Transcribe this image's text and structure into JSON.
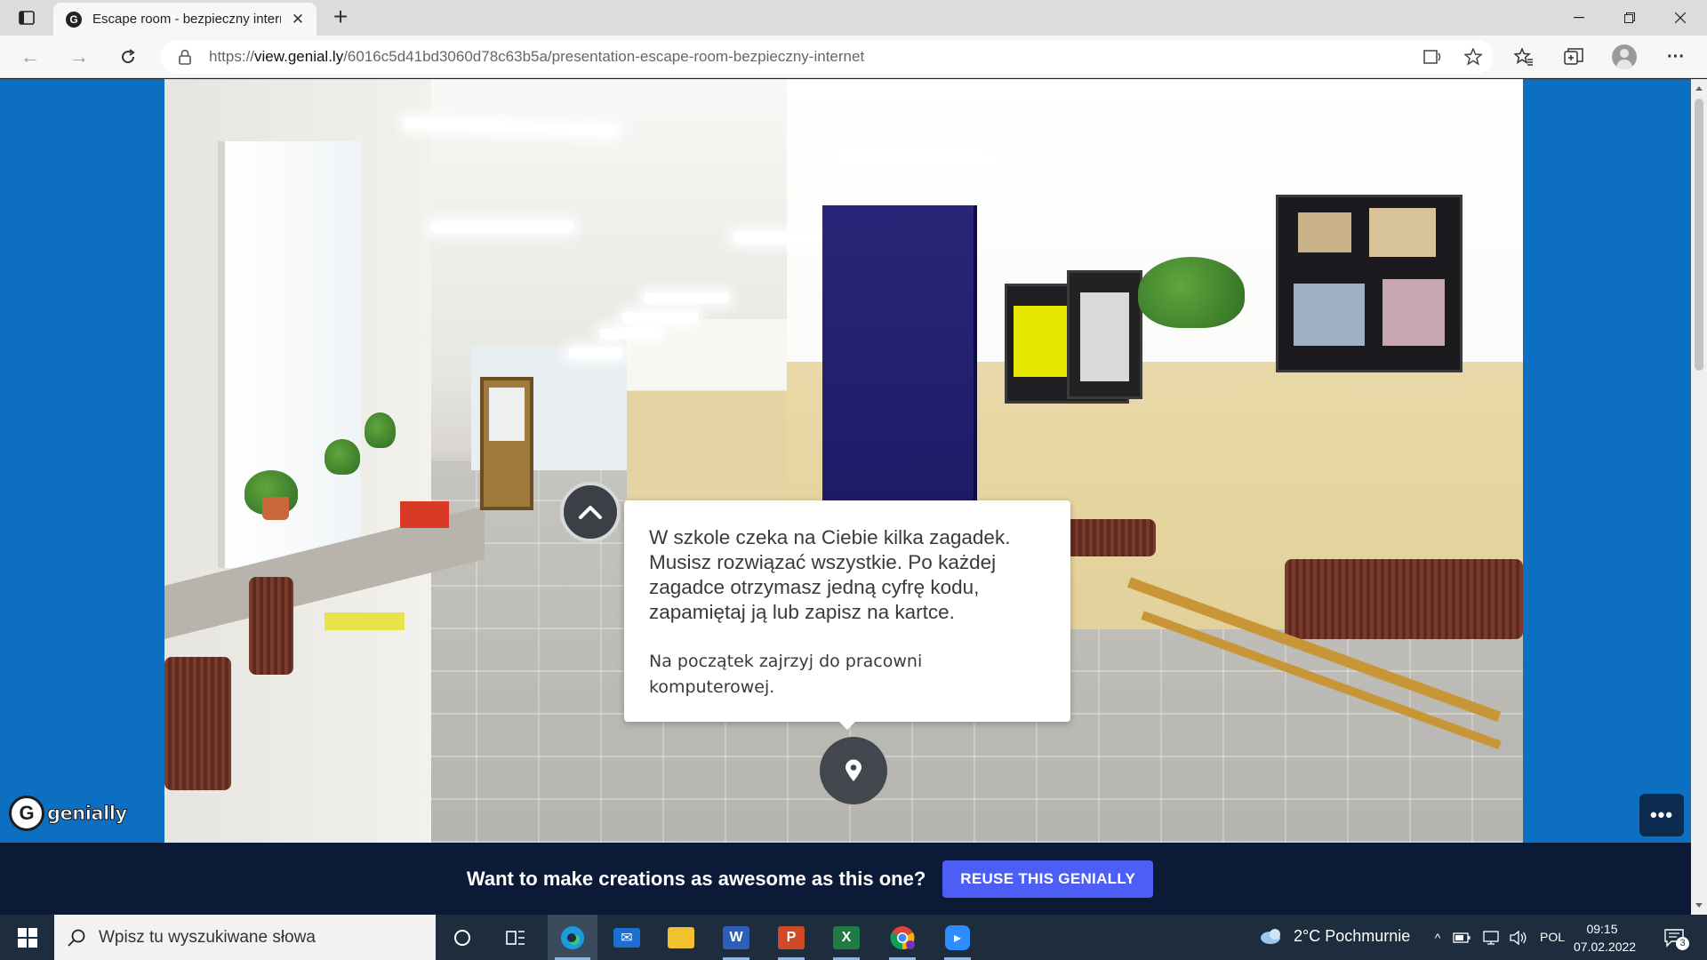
{
  "browser": {
    "tab": {
      "title": "Escape room - bezpieczny intern",
      "favicon": "genially-icon"
    },
    "new_tab_label": "+",
    "url": {
      "prefix": "https://",
      "domain": "view.genial.ly",
      "path": "/6016c5d41bd3060d78c63b5a/presentation-escape-room-bezpieczny-internet"
    },
    "icons": {
      "back": "back-arrow-icon",
      "forward": "forward-arrow-icon",
      "reload": "reload-icon",
      "lock": "lock-icon",
      "read_aloud": "immersive-reader-icon",
      "add_favorite": "add-favorite-icon",
      "favorites": "favorites-icon",
      "collections": "collections-icon",
      "profile": "profile-icon",
      "menu": "more-menu-icon"
    }
  },
  "presentation": {
    "card": {
      "main_text": "W szkole czeka na Ciebie kilka zagadek. Musisz rozwiązać wszystkie. Po każdej zagadce otrzymasz jedną cyfrę kodu, zapamiętaj ją lub zapisz na kartce.",
      "sub_text": "Na początek zajrzyj do pracowni komputerowej."
    },
    "logo_text": "genially",
    "promo": {
      "text": "Want to make creations as awesome as this one?",
      "button": "REUSE THIS GENIALLY"
    },
    "colors": {
      "page_background": "#0d6fc2",
      "promo_bar": "#0b1a36",
      "reuse_button": "#4d5ef6"
    }
  },
  "taskbar": {
    "search_placeholder": "Wpisz tu wyszukiwane słowa",
    "weather": "2°C  Pochmurnie",
    "language": "POL",
    "time": "09:15",
    "date": "07.02.2022",
    "notification_count": "3",
    "apps": [
      "cortana",
      "task-view",
      "edge",
      "mail",
      "file-explorer",
      "word",
      "powerpoint",
      "excel",
      "chrome",
      "zoom"
    ]
  }
}
